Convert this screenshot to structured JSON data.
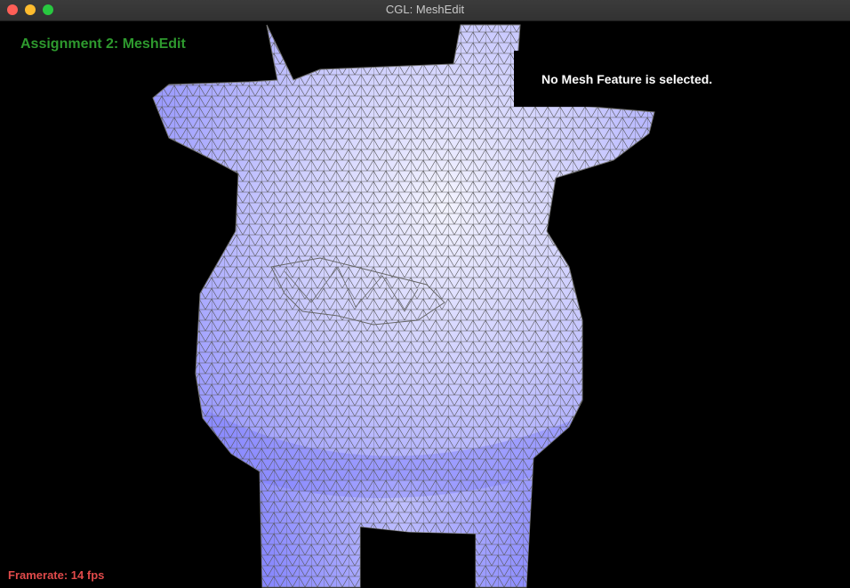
{
  "window": {
    "title": "CGL: MeshEdit"
  },
  "overlay": {
    "assignment_title": "Assignment 2: MeshEdit",
    "selection_info": "No Mesh Feature is selected.",
    "framerate": "Framerate: 14 fps"
  },
  "colors": {
    "mesh_fill": "#a9a9ff",
    "mesh_shadow": "#6c6cff",
    "wireframe": "#4a4a4a",
    "title_text": "#2e9a2e",
    "framerate_text": "#e04a4a",
    "background": "#000000"
  },
  "icons": {
    "close": "close-icon",
    "minimize": "minimize-icon",
    "maximize": "maximize-icon"
  }
}
